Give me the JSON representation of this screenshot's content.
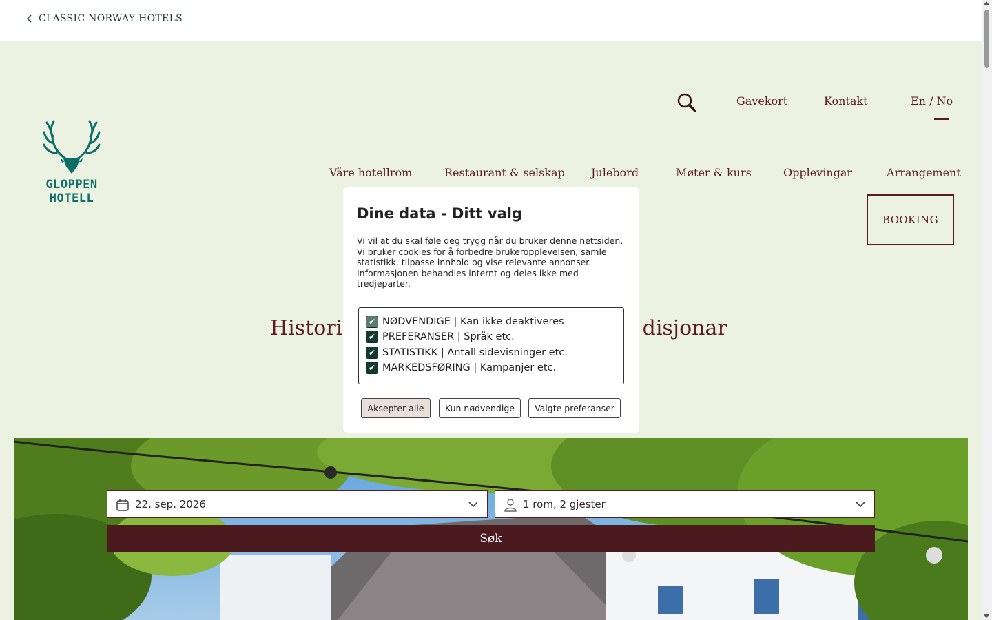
{
  "topbar": {
    "back_label": "CLASSIC NORWAY HOTELS"
  },
  "logo": {
    "text": "GLOPPEN HOTELL"
  },
  "utility_nav": {
    "gift_card": "Gavekort",
    "contact": "Kontakt",
    "language": "En / No"
  },
  "main_nav": {
    "items": [
      {
        "label": "Våre hotellrom"
      },
      {
        "label": "Restaurant & selskap"
      },
      {
        "label": "Julebord"
      },
      {
        "label": "Møter & kurs"
      },
      {
        "label": "Opplevingar"
      },
      {
        "label": "Arrangement"
      }
    ],
    "booking": "BOOKING"
  },
  "hero": {
    "headline_left": "Historis",
    "headline_right": "disjonar"
  },
  "search": {
    "date_value": "22. sep. 2026",
    "guests_value": "1 rom, 2 gjester",
    "submit_label": "Søk"
  },
  "cookie_modal": {
    "title": "Dine data - Ditt valg",
    "intro": "Vi vil at du skal føle deg trygg når du bruker denne nettsiden. Vi bruker cookies for å forbedre brukeropplevelsen, samle statistikk, tilpasse innhold og vise relevante annonser. Informasjonen behandles internt og deles ikke med tredjeparter.",
    "options": [
      {
        "label": "NØDVENDIGE | Kan ikke deaktiveres",
        "checked": true,
        "disabled": true
      },
      {
        "label": "PREFERANSER | Språk etc.",
        "checked": true,
        "disabled": false
      },
      {
        "label": "STATISTIKK | Antall sidevisninger etc.",
        "checked": true,
        "disabled": false
      },
      {
        "label": "MARKEDSFØRING | Kampanjer etc.",
        "checked": true,
        "disabled": false
      }
    ],
    "buttons": {
      "accept_all": "Aksepter alle",
      "necessary_only": "Kun nødvendige",
      "selected": "Valgte preferanser"
    }
  },
  "colors": {
    "brand_maroon": "#5a1a1f",
    "search_button": "#4a1a1e",
    "hero_background": "#ebf2e2",
    "logo_teal": "#0d6e68"
  }
}
